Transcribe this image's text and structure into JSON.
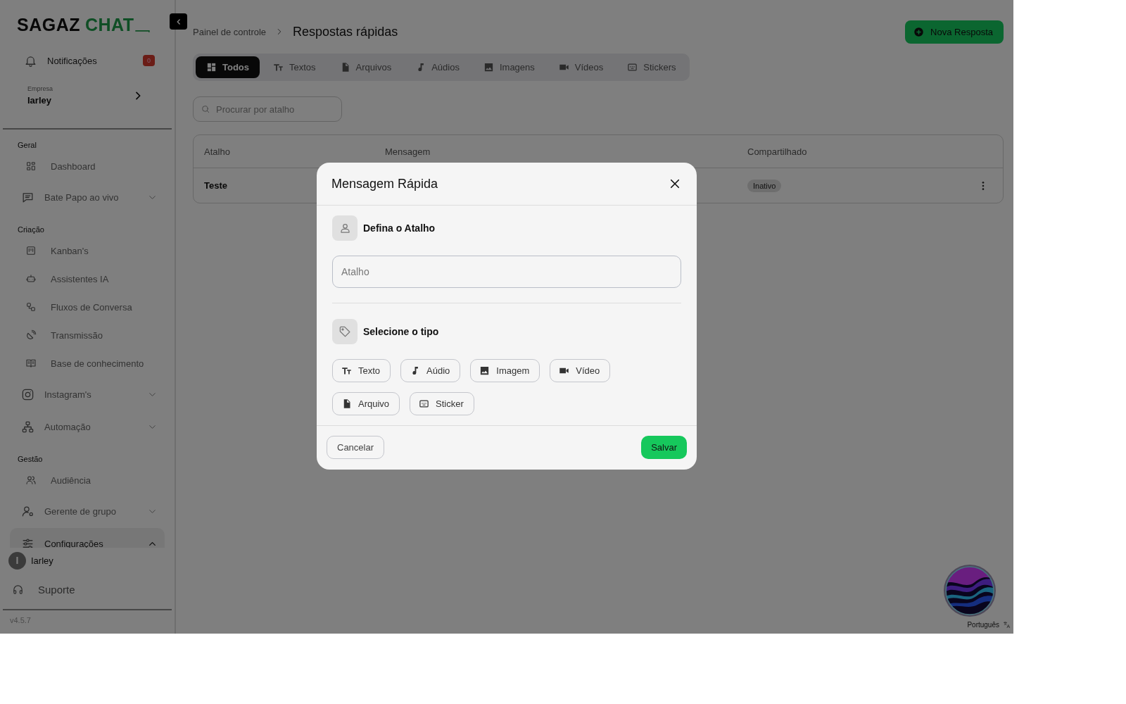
{
  "sidebar": {
    "logo": {
      "word": "SAGAZ",
      "accent": "CHAT"
    },
    "notifications": {
      "label": "Notificações",
      "count": "0"
    },
    "company": {
      "caption": "Empresa",
      "name": "Iarley"
    },
    "sections": [
      {
        "title": "Geral",
        "items": [
          {
            "label": "Dashboard",
            "kind": "link"
          },
          {
            "label": "Bate Papo ao vivo",
            "kind": "group",
            "expanded": false
          }
        ]
      },
      {
        "title": "Criação",
        "items": [
          {
            "label": "Kanban's",
            "kind": "link"
          },
          {
            "label": "Assistentes IA",
            "kind": "link"
          },
          {
            "label": "Fluxos de Conversa",
            "kind": "link"
          },
          {
            "label": "Transmissão",
            "kind": "link"
          },
          {
            "label": "Base de conhecimento",
            "kind": "link"
          },
          {
            "label": "Instagram's",
            "kind": "group",
            "expanded": false
          },
          {
            "label": "Automação",
            "kind": "group",
            "expanded": false
          }
        ]
      },
      {
        "title": "Gestão",
        "items": [
          {
            "label": "Audiência",
            "kind": "link"
          },
          {
            "label": "Gerente de grupo",
            "kind": "group",
            "expanded": false
          },
          {
            "label": "Configurações",
            "kind": "group",
            "expanded": true
          }
        ]
      }
    ],
    "user": {
      "initial": "I",
      "name": "Iarley"
    },
    "support": "Suporte",
    "version": "v4.5.7"
  },
  "header": {
    "breadcrumb": "Painel de controle",
    "title": "Respostas rápidas",
    "new_button": "Nova Resposta"
  },
  "tabs": [
    {
      "label": "Todos",
      "selected": true
    },
    {
      "label": "Textos",
      "selected": false
    },
    {
      "label": "Arquivos",
      "selected": false
    },
    {
      "label": "Aúdios",
      "selected": false
    },
    {
      "label": "Imagens",
      "selected": false
    },
    {
      "label": "Vídeos",
      "selected": false
    },
    {
      "label": "Stickers",
      "selected": false
    }
  ],
  "search": {
    "placeholder": "Procurar por atalho"
  },
  "table": {
    "columns": [
      "Atalho",
      "Mensagem",
      "Compartilhado"
    ],
    "rows": [
      {
        "shortcut": "Teste",
        "shared": "Inativo"
      }
    ]
  },
  "modal": {
    "title": "Mensagem Rápida",
    "shortcut_section": {
      "title": "Defina o Atalho",
      "placeholder": "Atalho"
    },
    "type_section": {
      "title": "Selecione o tipo",
      "options": [
        {
          "label": "Texto",
          "selected": false
        },
        {
          "label": "Aúdio",
          "selected": false
        },
        {
          "label": "Imagem",
          "selected": false
        },
        {
          "label": "Vídeo",
          "selected": false
        },
        {
          "label": "Arquivo",
          "selected": false
        },
        {
          "label": "Sticker",
          "selected": false
        }
      ]
    },
    "cancel": "Cancelar",
    "save": "Salvar"
  },
  "language": "Português"
}
